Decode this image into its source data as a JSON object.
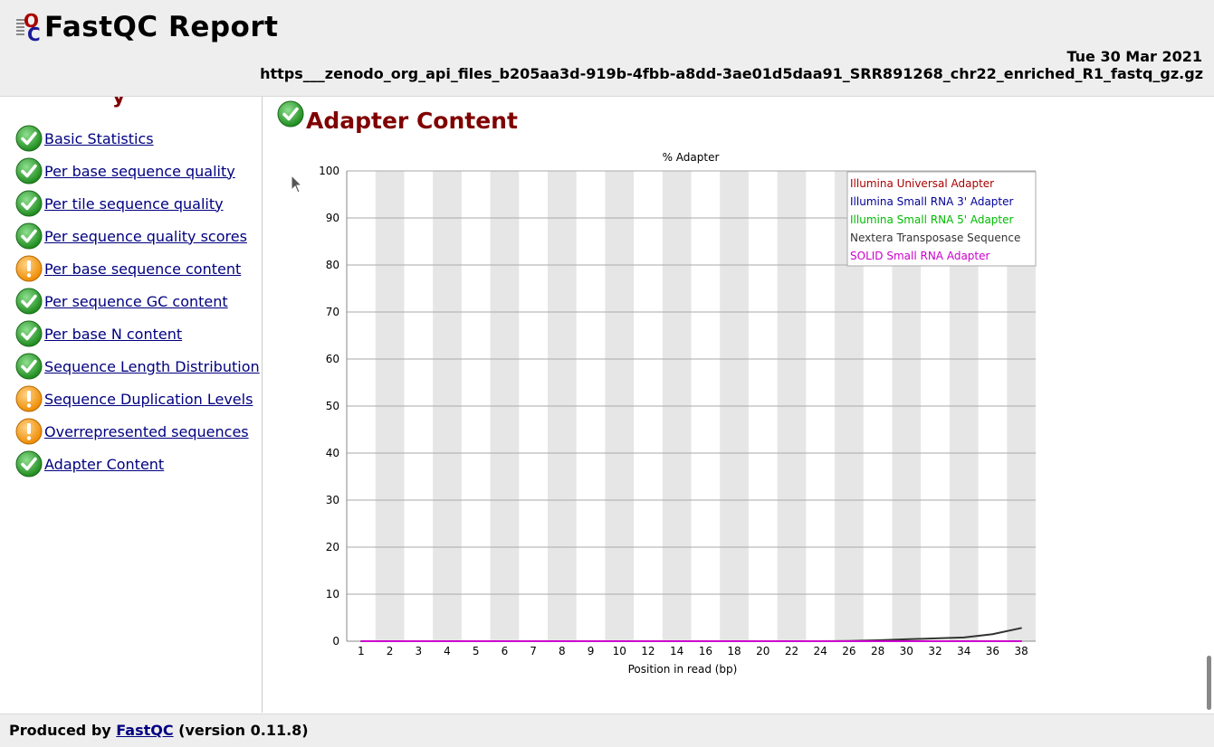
{
  "header": {
    "title": "FastQC Report",
    "date": "Tue 30 Mar 2021",
    "filename": "https___zenodo_org_api_files_b205aa3d-919b-4fbb-a8dd-3ae01d5daa91_SRR891268_chr22_enriched_R1_fastq_gz.gz"
  },
  "summary": {
    "heading_cut": "y",
    "items": [
      {
        "label": "Basic Statistics",
        "status": "pass",
        "icon": "pass-icon"
      },
      {
        "label": "Per base sequence quality",
        "status": "pass",
        "icon": "pass-icon"
      },
      {
        "label": "Per tile sequence quality",
        "status": "pass",
        "icon": "pass-icon"
      },
      {
        "label": "Per sequence quality scores",
        "status": "pass",
        "icon": "pass-icon"
      },
      {
        "label": "Per base sequence content",
        "status": "warn",
        "icon": "warning-icon"
      },
      {
        "label": "Per sequence GC content",
        "status": "pass",
        "icon": "pass-icon"
      },
      {
        "label": "Per base N content",
        "status": "pass",
        "icon": "pass-icon"
      },
      {
        "label": "Sequence Length Distribution",
        "status": "pass",
        "icon": "pass-icon"
      },
      {
        "label": "Sequence Duplication Levels",
        "status": "warn",
        "icon": "warning-icon"
      },
      {
        "label": "Overrepresented sequences",
        "status": "warn",
        "icon": "warning-icon"
      },
      {
        "label": "Adapter Content",
        "status": "pass",
        "icon": "pass-icon"
      }
    ]
  },
  "module": {
    "title": "Adapter Content",
    "status": "pass"
  },
  "colors": {
    "pass": "#2ea12e",
    "warn": "#f39c12",
    "link": "#000080",
    "heading": "#800000",
    "stripe": "#e6e6e6"
  },
  "chart_data": {
    "type": "line",
    "title": "% Adapter",
    "xlabel": "Position in read (bp)",
    "ylabel": "",
    "ylim": [
      0,
      100
    ],
    "yticks": [
      0,
      10,
      20,
      30,
      40,
      50,
      60,
      70,
      80,
      90,
      100
    ],
    "categories": [
      "1",
      "2",
      "3",
      "4",
      "5",
      "6",
      "7",
      "8",
      "9",
      "10",
      "12",
      "14",
      "16",
      "18",
      "20",
      "22",
      "24",
      "26",
      "28",
      "30",
      "32",
      "34",
      "36",
      "38"
    ],
    "legend_position": "top-right",
    "series": [
      {
        "name": "Illumina Universal Adapter",
        "color": "#aa0000",
        "values": [
          0,
          0,
          0,
          0,
          0,
          0,
          0,
          0,
          0,
          0,
          0,
          0,
          0,
          0,
          0,
          0,
          0,
          0,
          0,
          0,
          0,
          0,
          0,
          0
        ]
      },
      {
        "name": "Illumina Small RNA 3' Adapter",
        "color": "#000099",
        "values": [
          0,
          0,
          0,
          0,
          0,
          0,
          0,
          0,
          0,
          0,
          0,
          0,
          0,
          0,
          0,
          0,
          0,
          0,
          0,
          0,
          0,
          0,
          0,
          0
        ]
      },
      {
        "name": "Illumina Small RNA 5' Adapter",
        "color": "#00bb00",
        "values": [
          0,
          0,
          0,
          0,
          0,
          0,
          0,
          0,
          0,
          0,
          0,
          0,
          0,
          0,
          0,
          0,
          0,
          0,
          0,
          0,
          0,
          0,
          0,
          0
        ]
      },
      {
        "name": "Nextera Transposase Sequence",
        "color": "#333333",
        "values": [
          0,
          0,
          0,
          0,
          0,
          0,
          0,
          0,
          0,
          0,
          0,
          0,
          0,
          0,
          0,
          0,
          0,
          0.05,
          0.2,
          0.4,
          0.6,
          0.8,
          1.5,
          2.8
        ]
      },
      {
        "name": "SOLID Small RNA Adapter",
        "color": "#cc00cc",
        "values": [
          0,
          0,
          0,
          0,
          0,
          0,
          0,
          0,
          0,
          0,
          0,
          0,
          0,
          0,
          0,
          0,
          0,
          0,
          0,
          0,
          0,
          0,
          0,
          0
        ]
      }
    ]
  },
  "footer": {
    "produced_by": "Produced by",
    "link": "FastQC",
    "version": "(version 0.11.8)"
  }
}
